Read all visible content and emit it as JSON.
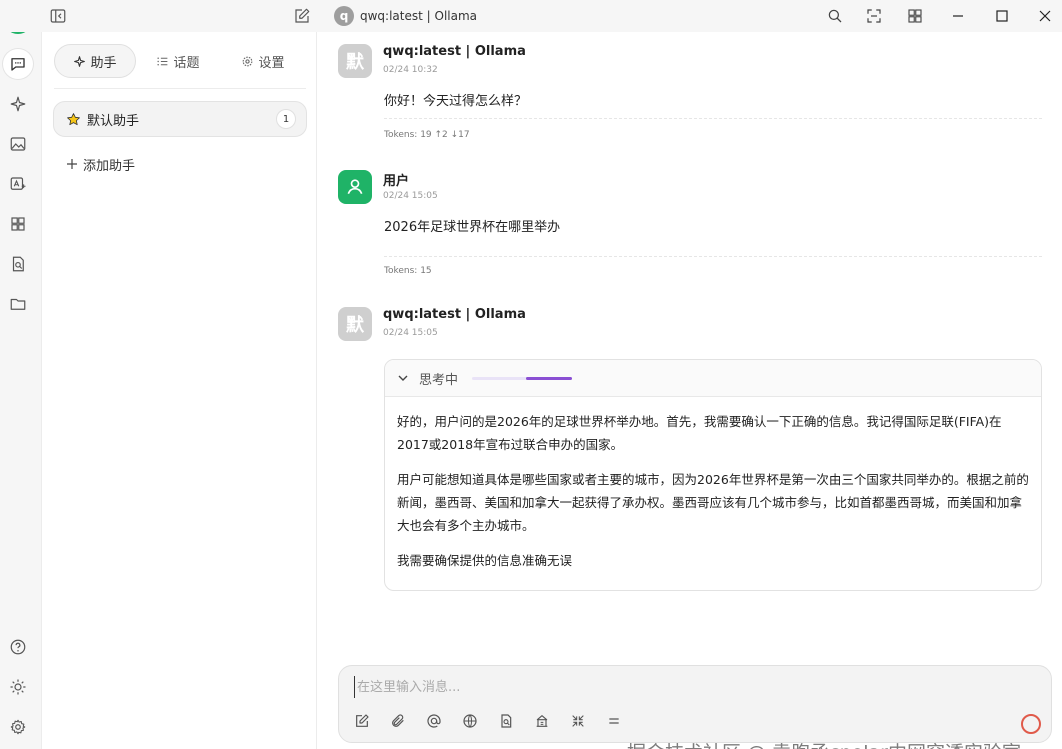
{
  "window": {
    "title": "qwq:latest | Ollama",
    "title_avatar": "q"
  },
  "tabs": [
    {
      "label": "助手",
      "icon": "sparkle-icon"
    },
    {
      "label": "话题",
      "icon": "list-icon"
    },
    {
      "label": "设置",
      "icon": "gear-icon"
    }
  ],
  "assistants": [
    {
      "name": "默认助手",
      "icon": "star-icon",
      "count": "1"
    }
  ],
  "add_assistant_label": "添加助手",
  "messages": [
    {
      "avatar": "默",
      "name": "qwq:latest | Ollama",
      "time": "02/24 10:32",
      "text": "你好！今天过得怎么样？",
      "tokens": "Tokens: 19 ↑2 ↓17"
    },
    {
      "avatar": "",
      "name": "用户",
      "time": "02/24 15:05",
      "text": "2026年足球世界杯在哪里举办",
      "tokens": "Tokens: 15"
    },
    {
      "avatar": "默",
      "name": "qwq:latest | Ollama",
      "time": "02/24 15:05"
    }
  ],
  "thinking": {
    "label": "思考中",
    "progress": 0.46,
    "paragraphs": [
      "好的，用户问的是2026年的足球世界杯举办地。首先，我需要确认一下正确的信息。我记得国际足联(FIFA)在2017或2018年宣布过联合申办的国家。",
      "用户可能想知道具体是哪些国家或者主要的城市，因为2026年世界杯是第一次由三个国家共同举办的。根据之前的新闻，墨西哥、美国和加拿大一起获得了承办权。墨西哥应该有几个城市参与，比如首都墨西哥城，而美国和加拿大也会有多个主办城市。",
      "我需要确保提供的信息准确无误"
    ]
  },
  "input": {
    "placeholder": "在这里输入消息..."
  },
  "watermark": "掘金技术社区 @ 袁煦丞cpolar内网穿透实验室",
  "colors": {
    "brand_green": "#1fb367",
    "accent_purple": "#8a4fd3"
  }
}
